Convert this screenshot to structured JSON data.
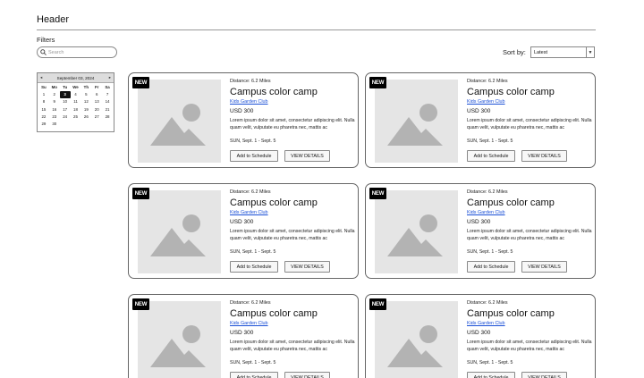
{
  "header": {
    "title": "Header"
  },
  "filters": {
    "label": "Filters",
    "search_placeholder": "Search"
  },
  "sort": {
    "label": "Sort by:",
    "selected": "Latest"
  },
  "calendar": {
    "month_label": "September 03, 2024",
    "prev": "◂",
    "next": "▸",
    "weekdays": [
      "Su",
      "Mo",
      "Tu",
      "We",
      "Th",
      "Fr",
      "Sa"
    ],
    "days": [
      "1",
      "2",
      "3",
      "4",
      "5",
      "6",
      "7",
      "8",
      "9",
      "10",
      "11",
      "12",
      "13",
      "14",
      "15",
      "16",
      "17",
      "18",
      "19",
      "20",
      "21",
      "22",
      "23",
      "24",
      "25",
      "26",
      "27",
      "28",
      "29",
      "30"
    ],
    "selected_day": "3"
  },
  "cards": [
    {
      "badge": "NEW",
      "distance": "Distance: 6.2 Miles",
      "title": "Campus color camp",
      "host": "Kids Garden Club",
      "price": "USD 300",
      "description": "Lorem ipsum dolor sit amet, consectetur adipiscing elit. Nulla quam velit, vulputate eu pharetra nec, mattis ac",
      "dates": "SUN, Sept. 1 - Sept. 5",
      "add_label": "Add to Schedule",
      "view_label": "VIEW DETAILS"
    },
    {
      "badge": "NEW",
      "distance": "Distance: 6.2 Miles",
      "title": "Campus color camp",
      "host": "Kids Garden Club",
      "price": "USD 300",
      "description": "Lorem ipsum dolor sit amet, consectetur adipiscing elit. Nulla quam velit, vulputate eu pharetra nec, mattis ac",
      "dates": "SUN, Sept. 1 - Sept. 5",
      "add_label": "Add to Schedule",
      "view_label": "VIEW DETAILS"
    },
    {
      "badge": "NEW",
      "distance": "Distance: 6.2 Miles",
      "title": "Campus color camp",
      "host": "Kids Garden Club",
      "price": "USD 300",
      "description": "Lorem ipsum dolor sit amet, consectetur adipiscing elit. Nulla quam velit, vulputate eu pharetra nec, mattis ac",
      "dates": "SUN, Sept. 1 - Sept. 5",
      "add_label": "Add to Schedule",
      "view_label": "VIEW DETAILS"
    },
    {
      "badge": "NEW",
      "distance": "Distance: 6.2 Miles",
      "title": "Campus color camp",
      "host": "Kids Garden Club",
      "price": "USD 300",
      "description": "Lorem ipsum dolor sit amet, consectetur adipiscing elit. Nulla quam velit, vulputate eu pharetra nec, mattis ac",
      "dates": "SUN, Sept. 1 - Sept. 5",
      "add_label": "Add to Schedule",
      "view_label": "VIEW DETAILS"
    },
    {
      "badge": "NEW",
      "distance": "Distance: 6.2 Miles",
      "title": "Campus color camp",
      "host": "Kids Garden Club",
      "price": "USD 300",
      "description": "Lorem ipsum dolor sit amet, consectetur adipiscing elit. Nulla quam velit, vulputate eu pharetra nec, mattis ac",
      "dates": "SUN, Sept. 1 - Sept. 5",
      "add_label": "Add to Schedule",
      "view_label": "VIEW DETAILS"
    },
    {
      "badge": "NEW",
      "distance": "Distance: 6.2 Miles",
      "title": "Campus color camp",
      "host": "Kids Garden Club",
      "price": "USD 300",
      "description": "Lorem ipsum dolor sit amet, consectetur adipiscing elit. Nulla quam velit, vulputate eu pharetra nec, mattis ac",
      "dates": "SUN, Sept. 1 - Sept. 5",
      "add_label": "Add to Schedule",
      "view_label": "VIEW DETAILS"
    }
  ],
  "icons": {
    "search": "search-icon",
    "dropdown": "chevron-down-icon",
    "thumbnail": "image-placeholder-icon"
  },
  "colors": {
    "link": "#1a4fd6",
    "badge_bg": "#000000",
    "placeholder_bg": "#e5e5e5",
    "placeholder_shape": "#b3b3b3"
  }
}
